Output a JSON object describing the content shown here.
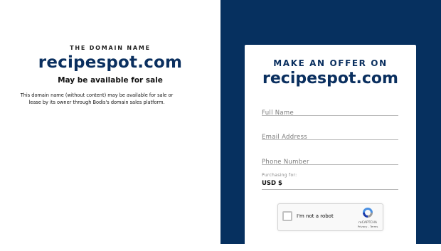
{
  "left": {
    "eyebrow": "THE DOMAIN NAME",
    "domain": "recipespot.com",
    "availability": "May be available for sale",
    "description": "This domain name (without content) may be available for sale or lease by its owner through Bodis's domain sales platform."
  },
  "offer": {
    "title": "MAKE AN OFFER ON",
    "domain": "recipespot.com",
    "fields": {
      "full_name_placeholder": "Full Name",
      "email_placeholder": "Email Address",
      "phone_placeholder": "Phone Number"
    },
    "purchasing_label": "Purchasing for:",
    "currency": "USD $"
  },
  "captcha": {
    "label": "I'm not a robot",
    "brand": "reCAPTCHA",
    "links": "Privacy - Terms"
  },
  "colors": {
    "navy": "#06305f",
    "domain_text": "#0a2f5f"
  }
}
